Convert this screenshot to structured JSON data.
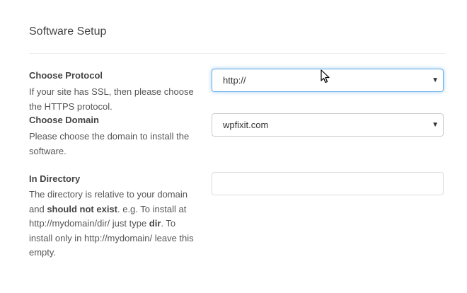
{
  "section": {
    "title": "Software Setup"
  },
  "protocol": {
    "label": "Choose Protocol",
    "description": "If your site has SSL, then please choose the HTTPS protocol.",
    "selected": "http://"
  },
  "domain": {
    "label": "Choose Domain",
    "description": "Please choose the domain to install the software.",
    "selected": "wpfixit.com"
  },
  "directory": {
    "label": "In Directory",
    "desc_part1": "The directory is relative to your domain and ",
    "desc_bold1": "should not exist",
    "desc_part2": ". e.g. To install at http://mydomain/dir/ just type ",
    "desc_bold2": "dir",
    "desc_part3": ". To install only in http://mydomain/ leave this empty.",
    "value": ""
  },
  "icons": {
    "caret": "dropdown-caret-icon",
    "cursor": "mouse-pointer-icon"
  },
  "colors": {
    "focus_border": "#66afe9",
    "input_border": "#cccccc"
  }
}
